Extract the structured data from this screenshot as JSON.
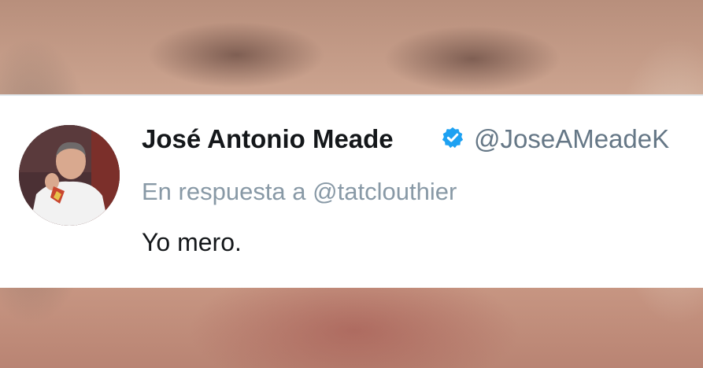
{
  "tweet": {
    "author_name": "José Antonio Meade",
    "author_handle": "@JoseAMeadeK",
    "verified": true,
    "verified_icon": "verified-badge-icon",
    "reply_prefix": "En respuesta a",
    "reply_to": "@tatclouthier",
    "text": "Yo mero."
  },
  "colors": {
    "card_background": "#ffffff",
    "name": "#14171a",
    "handle": "#657786",
    "reply": "#8899a6",
    "verified_badge": "#1da1f2"
  }
}
